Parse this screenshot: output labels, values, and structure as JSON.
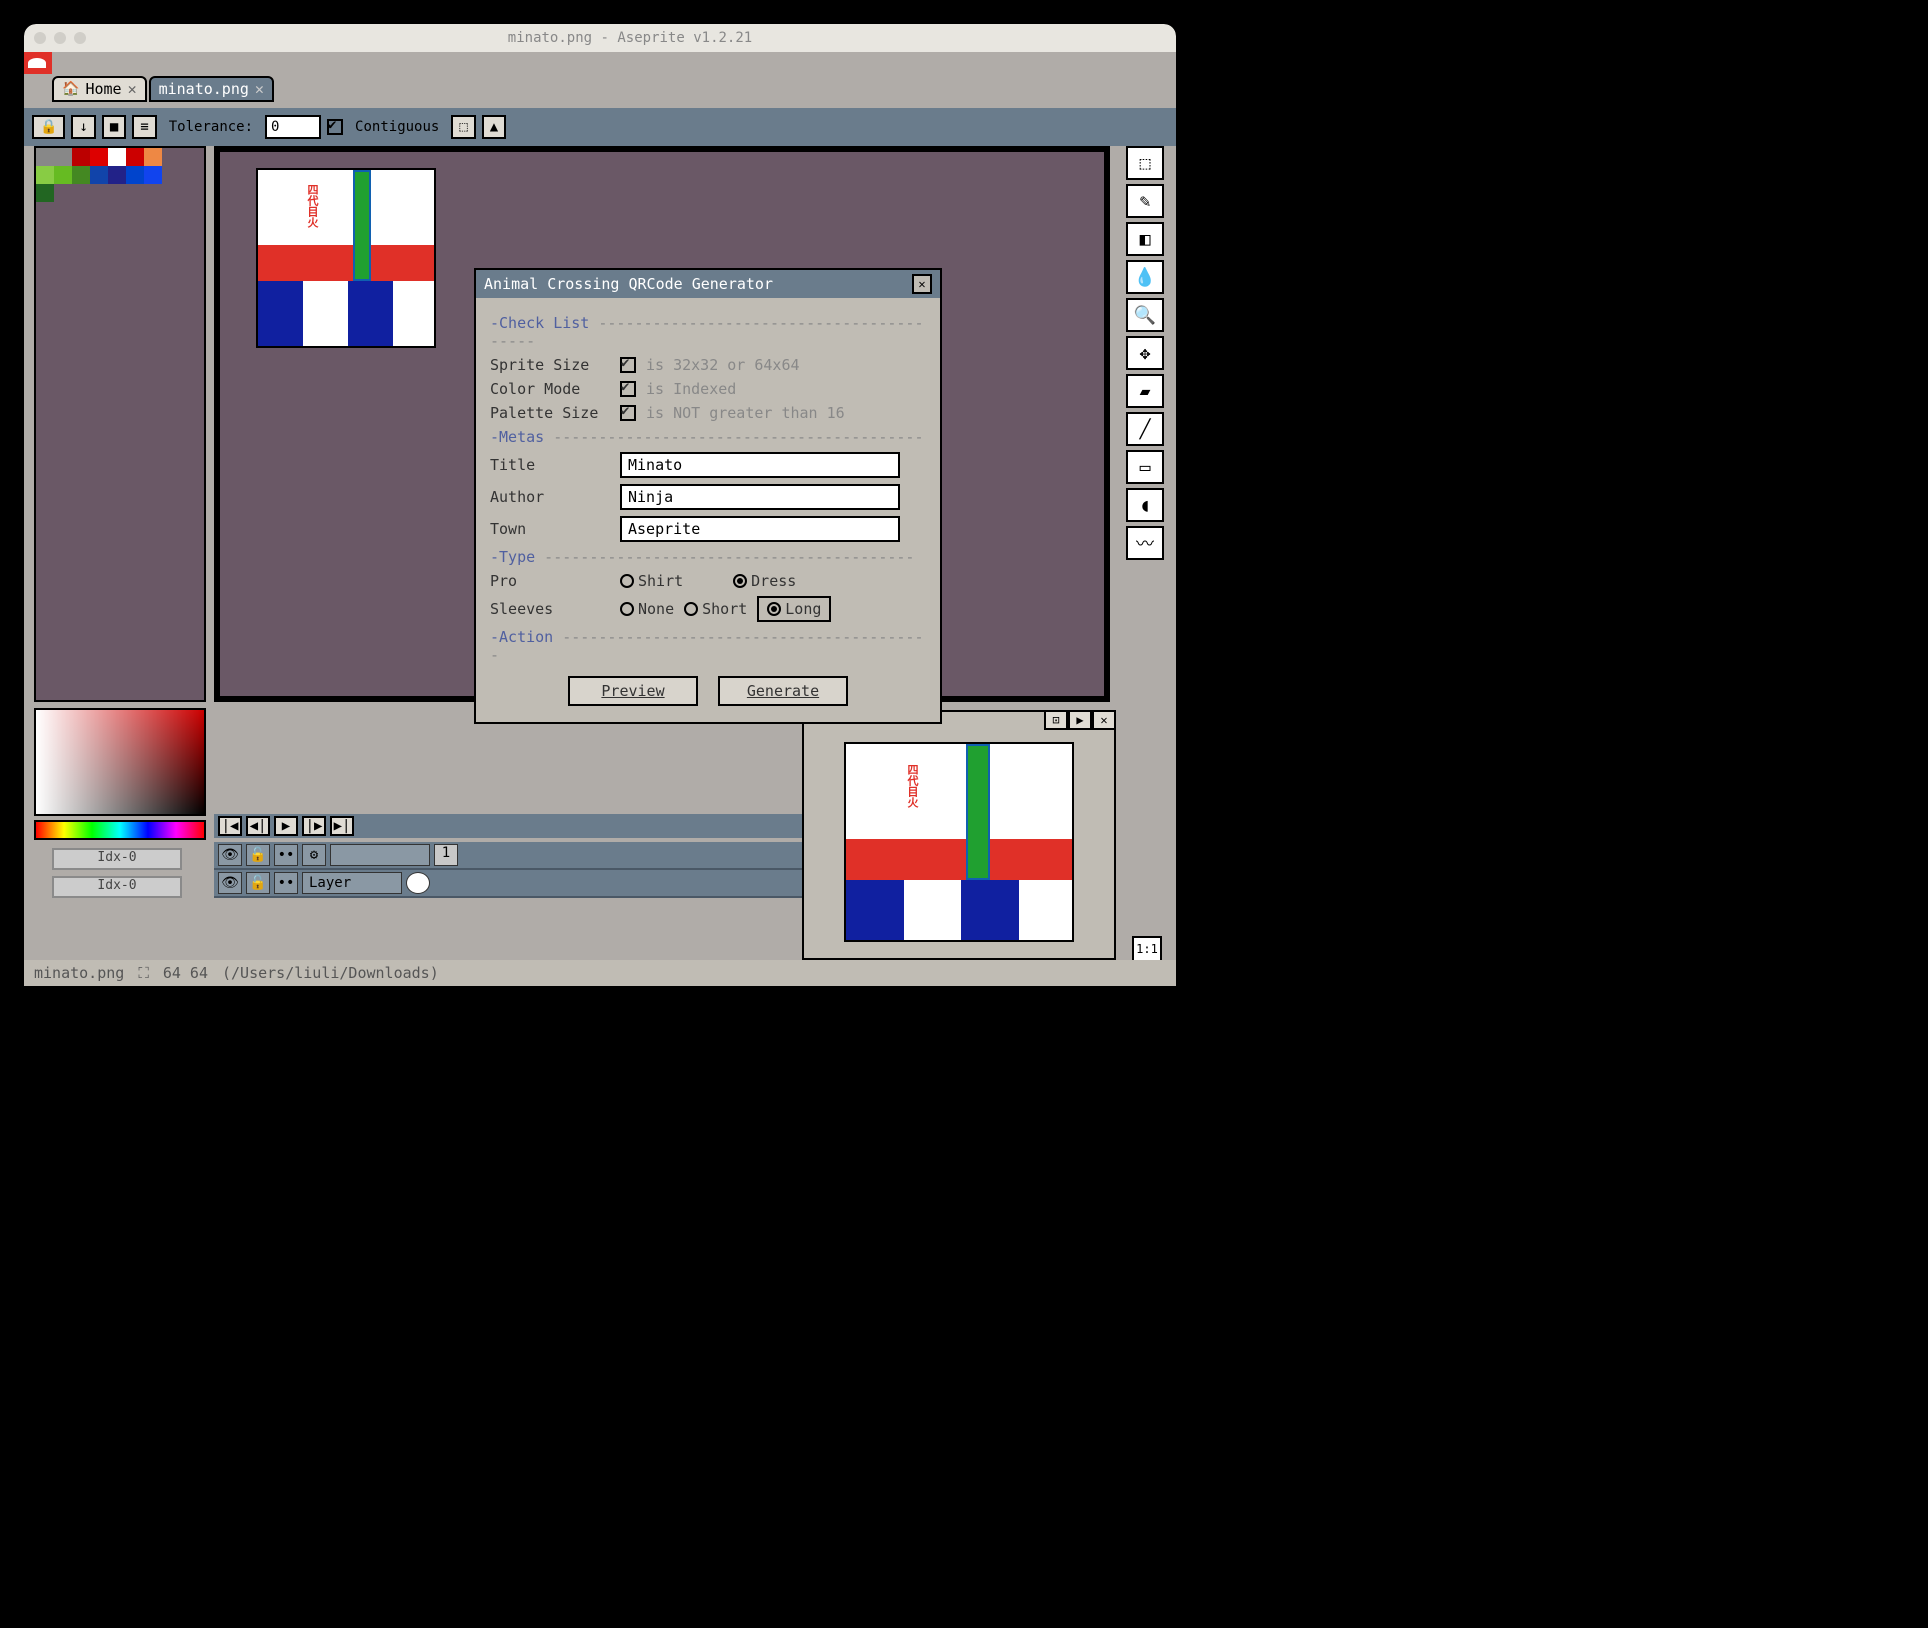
{
  "window": {
    "title": "minato.png - Aseprite v1.2.21"
  },
  "tabs": [
    {
      "label": "Home",
      "icon": "🏠"
    },
    {
      "label": "minato.png",
      "active": true
    }
  ],
  "optionbar": {
    "tolerance_label": "Tolerance:",
    "tolerance": "0",
    "contiguous": "Contiguous"
  },
  "idx_buttons": {
    "a": "Idx-0",
    "b": "Idx-0"
  },
  "timeline": {
    "header_frame": "1",
    "layer_name": "Layer"
  },
  "status": {
    "file": "minato.png",
    "dims": "64  64",
    "path": "(/Users/liuli/Downloads)"
  },
  "dialog": {
    "title": "Animal Crossing QRCode Generator",
    "sections": {
      "checklist": "-Check List",
      "metas": "-Metas",
      "type": "-Type",
      "action": "-Action"
    },
    "checklist": {
      "sprite_size": {
        "label": "Sprite Size",
        "value": "is 32x32 or 64x64"
      },
      "color_mode": {
        "label": "Color Mode",
        "value": "is Indexed"
      },
      "palette_size": {
        "label": "Palette Size",
        "value": "is NOT greater than 16"
      }
    },
    "metas": {
      "title": {
        "label": "Title",
        "value": "Minato"
      },
      "author": {
        "label": "Author",
        "value": "Ninja"
      },
      "town": {
        "label": "Town",
        "value": "Aseprite"
      }
    },
    "type": {
      "pro": {
        "label": "Pro",
        "options": [
          "Shirt",
          "Dress"
        ],
        "selected": "Dress"
      },
      "sleeves": {
        "label": "Sleeves",
        "options": [
          "None",
          "Short",
          "Long"
        ],
        "selected": "Long"
      }
    },
    "buttons": {
      "preview": "Preview",
      "generate": "Generate"
    }
  },
  "ratio_label": "1:1",
  "sprite_text": "四代目火"
}
